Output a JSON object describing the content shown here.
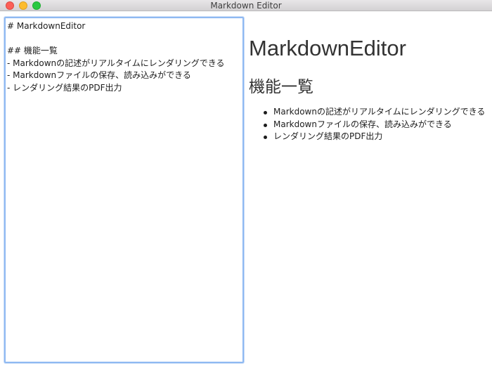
{
  "window": {
    "title": "Markdown Editor"
  },
  "editor": {
    "lines": [
      "# MarkdownEditor",
      "",
      "## 機能一覧",
      "- Markdownの記述がリアルタイムにレンダリングできる",
      "- Markdownファイルの保存、読み込みができる",
      "- レンダリング結果のPDF出力"
    ]
  },
  "preview": {
    "h1": "MarkdownEditor",
    "h2": "機能一覧",
    "items": [
      "Markdownの記述がリアルタイムにレンダリングできる",
      "Markdownファイルの保存、読み込みができる",
      "レンダリング結果のPDF出力"
    ]
  },
  "colors": {
    "focus_ring": "#8fb9f2",
    "close": "#fc5f57",
    "minimize": "#fdbc2e",
    "zoom": "#28c840"
  }
}
